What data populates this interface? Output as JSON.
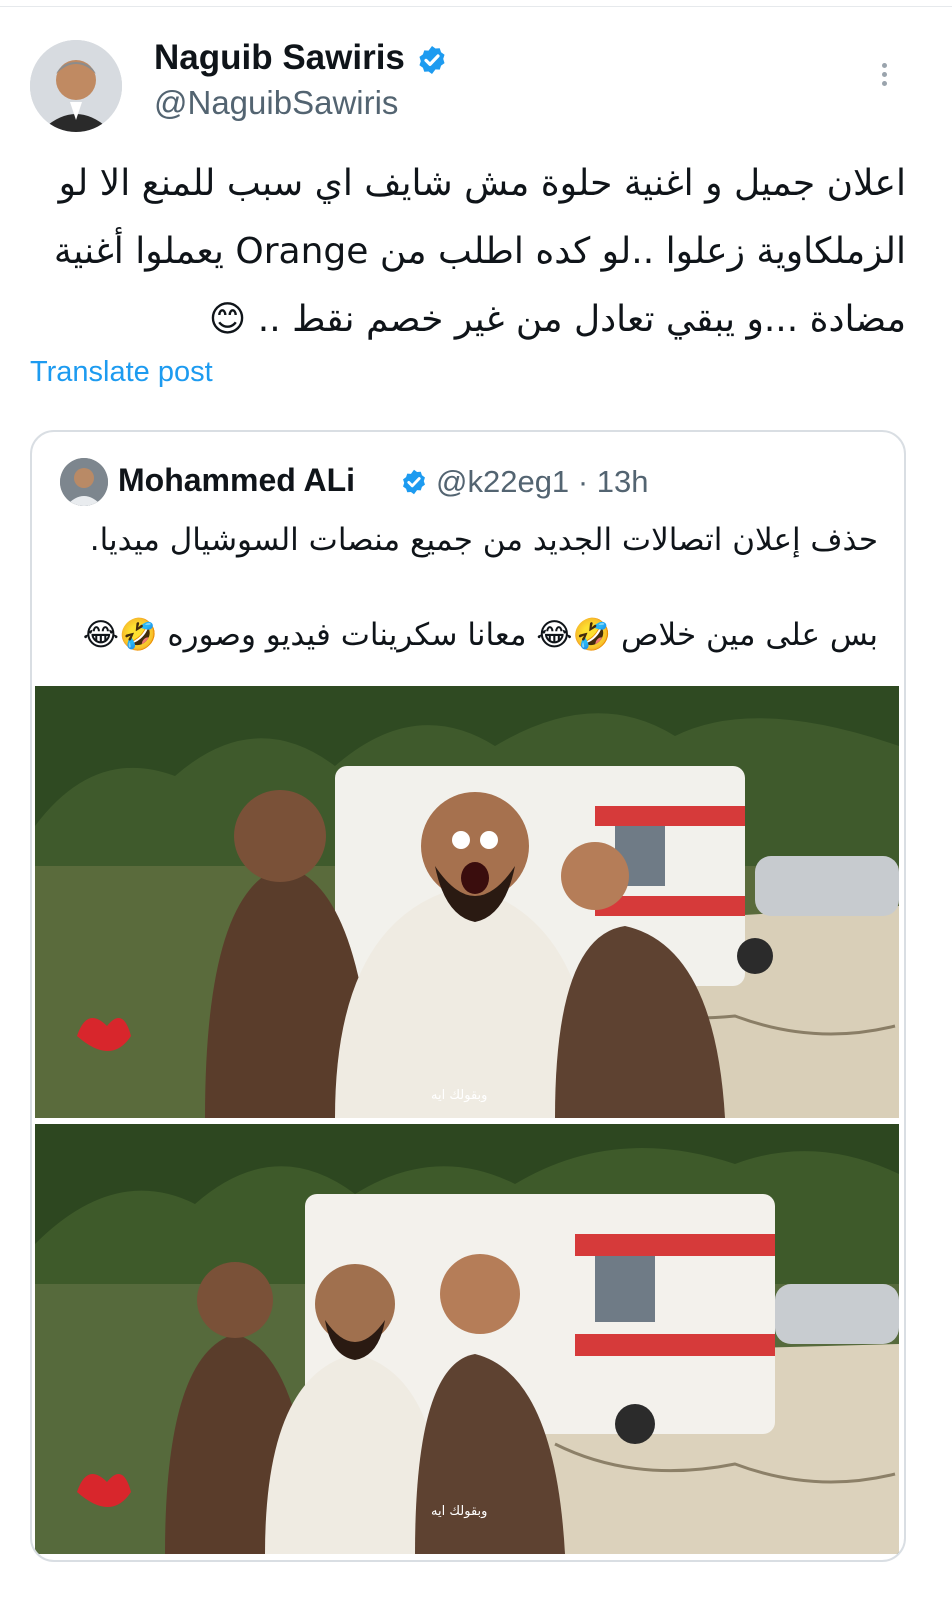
{
  "post": {
    "author": {
      "name": "Naguib Sawiris",
      "handle": "@NaguibSawiris"
    },
    "text_lines": [
      "اعلان جميل و اغنية حلوة مش شايف اي سبب للمنع الا لو",
      "الزملكاوية زعلوا ..لو كده اطلب من Orange يعملوا أغنية",
      "مضادة ...و يبقي تعادل من غير خصم نقط .. 😊"
    ],
    "translate_label": "Translate post"
  },
  "quote": {
    "author": {
      "name": "Mohammed ALi",
      "handle": "@k22eg1",
      "separator": "·",
      "time": "13h"
    },
    "text_line1": "حذف إعلان اتصالات الجديد من جميع منصات السوشيال ميديا.",
    "text_line2": "بس على مين خلاص 🤣😂 معانا سكرينات فيديو وصوره 🤣😂",
    "media": [
      {
        "caption": "وبقولك ايه"
      },
      {
        "caption": "وبقولك ايه"
      }
    ]
  },
  "colors": {
    "link": "#1d9bf0",
    "verified": "#1d9bf0",
    "secondary_text": "#536471",
    "border": "#d9dee3"
  },
  "icons": [
    "verified-badge-icon",
    "more-options-icon"
  ]
}
